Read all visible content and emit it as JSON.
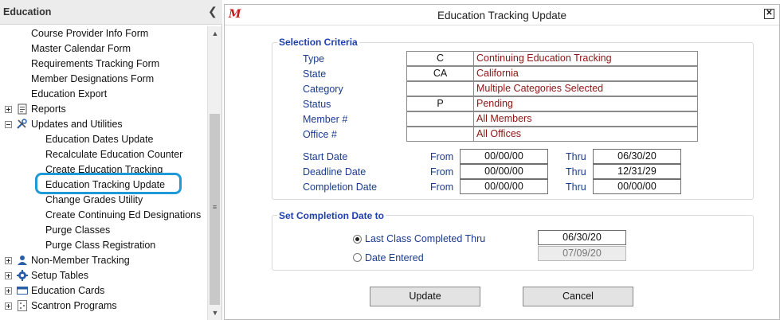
{
  "sidebar": {
    "title": "Education",
    "items": [
      {
        "label": "Course Provider Info Form"
      },
      {
        "label": "Master Calendar Form"
      },
      {
        "label": "Requirements Tracking Form"
      },
      {
        "label": "Member Designations Form"
      },
      {
        "label": "Education Export"
      },
      {
        "label": "Reports"
      },
      {
        "label": "Updates and Utilities"
      },
      {
        "label": "Education Dates Update"
      },
      {
        "label": "Recalculate Education Counter"
      },
      {
        "label": "Create Education Tracking"
      },
      {
        "label": "Education Tracking Update"
      },
      {
        "label": "Change Grades Utility"
      },
      {
        "label": "Create Continuing Ed Designations"
      },
      {
        "label": "Purge Classes"
      },
      {
        "label": "Purge Class Registration"
      },
      {
        "label": "Non-Member Tracking"
      },
      {
        "label": "Setup Tables"
      },
      {
        "label": "Education Cards"
      },
      {
        "label": "Scantron Programs"
      }
    ]
  },
  "dialog": {
    "title": "Education Tracking Update",
    "app_logo": "M",
    "selection": {
      "label": "Selection Criteria",
      "rows": [
        {
          "label": "Type",
          "code": "C",
          "desc": "Continuing Education Tracking"
        },
        {
          "label": "State",
          "code": "CA",
          "desc": "California"
        },
        {
          "label": "Category",
          "code": "",
          "desc": "Multiple Categories Selected"
        },
        {
          "label": "Status",
          "code": "P",
          "desc": "Pending"
        },
        {
          "label": "Member #",
          "code": "",
          "desc": "All Members"
        },
        {
          "label": "Office #",
          "code": "",
          "desc": "All Offices"
        }
      ],
      "from_label": "From",
      "thru_label": "Thru",
      "dates": [
        {
          "label": "Start Date",
          "from": "00/00/00",
          "thru": "06/30/20"
        },
        {
          "label": "Deadline Date",
          "from": "00/00/00",
          "thru": "12/31/29"
        },
        {
          "label": "Completion Date",
          "from": "00/00/00",
          "thru": "00/00/00"
        }
      ]
    },
    "completion": {
      "label": "Set Completion Date to",
      "options": [
        {
          "label": "Last Class Completed Thru",
          "value": "06/30/20",
          "selected": true
        },
        {
          "label": "Date Entered",
          "value": "07/09/20",
          "selected": false
        }
      ]
    },
    "buttons": {
      "update": "Update",
      "cancel": "Cancel"
    }
  },
  "colors": {
    "label_blue": "#1a3b8f",
    "group_title_blue": "#1f3fae",
    "desc_red": "#8c1414",
    "highlight": "#1e9bd7"
  },
  "icons": {
    "reports": "report-icon",
    "updates": "tools-icon",
    "non_member": "people-icon",
    "setup": "gear-icon",
    "cards": "card-icon",
    "scantron": "scantron-icon"
  }
}
